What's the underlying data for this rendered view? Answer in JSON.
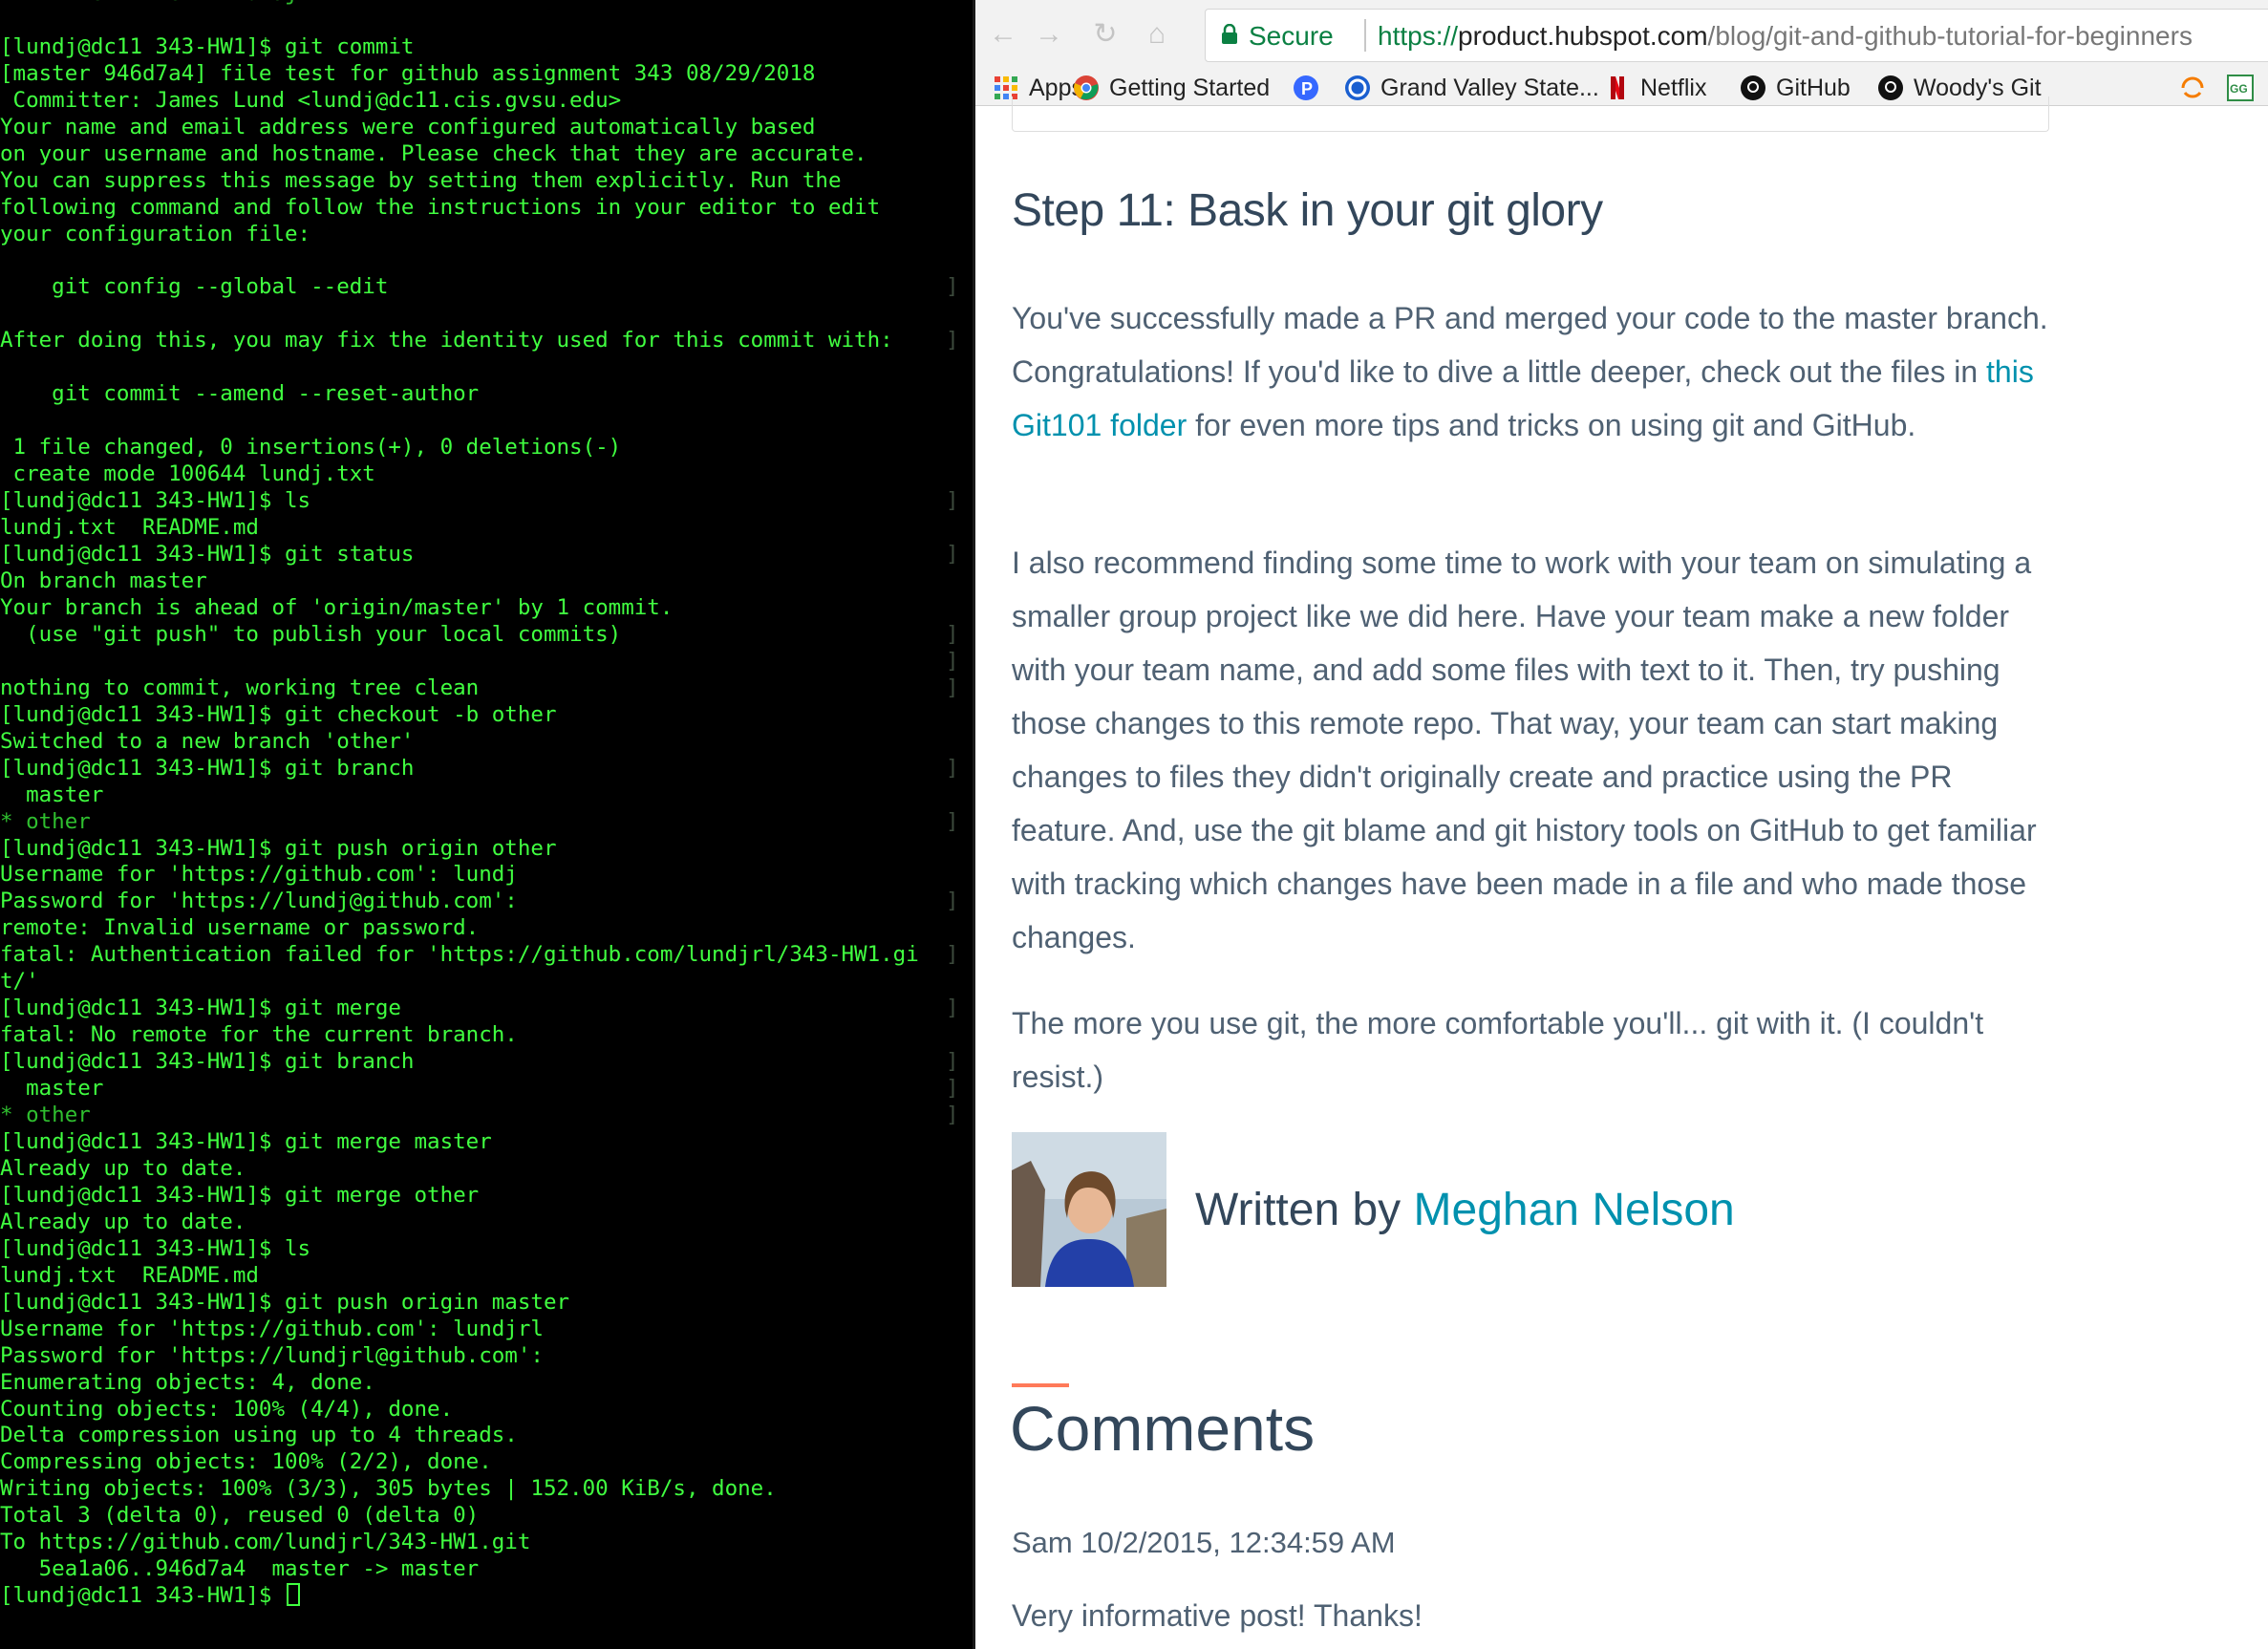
{
  "terminal": {
    "lines": [
      {
        "text": "      new file:   lundj.txt",
        "bracket": false,
        "dim": true
      },
      {
        "text": "",
        "bracket": false
      },
      {
        "text": "[lundj@dc11 343-HW1]$ git commit",
        "bracket": false
      },
      {
        "text": "[master 946d7a4] file test for github assignment 343 08/29/2018",
        "bracket": false
      },
      {
        "text": " Committer: James Lund <lundj@dc11.cis.gvsu.edu>",
        "bracket": false
      },
      {
        "text": "Your name and email address were configured automatically based",
        "bracket": false
      },
      {
        "text": "on your username and hostname. Please check that they are accurate.",
        "bracket": false
      },
      {
        "text": "You can suppress this message by setting them explicitly. Run the",
        "bracket": false
      },
      {
        "text": "following command and follow the instructions in your editor to edit",
        "bracket": false
      },
      {
        "text": "your configuration file:",
        "bracket": false
      },
      {
        "text": "",
        "bracket": false
      },
      {
        "text": "    git config --global --edit",
        "bracket": true
      },
      {
        "text": "",
        "bracket": false
      },
      {
        "text": "After doing this, you may fix the identity used for this commit with:",
        "bracket": true
      },
      {
        "text": "",
        "bracket": false
      },
      {
        "text": "    git commit --amend --reset-author",
        "bracket": false
      },
      {
        "text": "",
        "bracket": false
      },
      {
        "text": " 1 file changed, 0 insertions(+), 0 deletions(-)",
        "bracket": false
      },
      {
        "text": " create mode 100644 lundj.txt",
        "bracket": false
      },
      {
        "text": "[lundj@dc11 343-HW1]$ ls",
        "bracket": true
      },
      {
        "text": "lundj.txt  README.md",
        "bracket": false
      },
      {
        "text": "[lundj@dc11 343-HW1]$ git status",
        "bracket": true
      },
      {
        "text": "On branch master",
        "bracket": false
      },
      {
        "text": "Your branch is ahead of 'origin/master' by 1 commit.",
        "bracket": false
      },
      {
        "text": "  (use \"git push\" to publish your local commits)",
        "bracket": true
      },
      {
        "text": "",
        "bracket": true
      },
      {
        "text": "nothing to commit, working tree clean",
        "bracket": true
      },
      {
        "text": "[lundj@dc11 343-HW1]$ git checkout -b other",
        "bracket": false
      },
      {
        "text": "Switched to a new branch 'other'",
        "bracket": false
      },
      {
        "text": "[lundj@dc11 343-HW1]$ git branch",
        "bracket": true
      },
      {
        "text": "  master",
        "bracket": false
      },
      {
        "text": "* other",
        "bracket": true,
        "dim": true
      },
      {
        "text": "[lundj@dc11 343-HW1]$ git push origin other",
        "bracket": false
      },
      {
        "text": "Username for 'https://github.com': lundj",
        "bracket": false
      },
      {
        "text": "Password for 'https://lundj@github.com':",
        "bracket": true
      },
      {
        "text": "remote: Invalid username or password.",
        "bracket": false
      },
      {
        "text": "fatal: Authentication failed for 'https://github.com/lundjrl/343-HW1.gi",
        "bracket": true
      },
      {
        "text": "t/'",
        "bracket": false
      },
      {
        "text": "[lundj@dc11 343-HW1]$ git merge",
        "bracket": true
      },
      {
        "text": "fatal: No remote for the current branch.",
        "bracket": false
      },
      {
        "text": "[lundj@dc11 343-HW1]$ git branch",
        "bracket": true
      },
      {
        "text": "  master",
        "bracket": true
      },
      {
        "text": "* other",
        "bracket": true,
        "dim": true
      },
      {
        "text": "[lundj@dc11 343-HW1]$ git merge master",
        "bracket": false
      },
      {
        "text": "Already up to date.",
        "bracket": false
      },
      {
        "text": "[lundj@dc11 343-HW1]$ git merge other",
        "bracket": false
      },
      {
        "text": "Already up to date.",
        "bracket": false
      },
      {
        "text": "[lundj@dc11 343-HW1]$ ls",
        "bracket": false
      },
      {
        "text": "lundj.txt  README.md",
        "bracket": false
      },
      {
        "text": "[lundj@dc11 343-HW1]$ git push origin master",
        "bracket": false
      },
      {
        "text": "Username for 'https://github.com': lundjrl",
        "bracket": false
      },
      {
        "text": "Password for 'https://lundjrl@github.com':",
        "bracket": false
      },
      {
        "text": "Enumerating objects: 4, done.",
        "bracket": false
      },
      {
        "text": "Counting objects: 100% (4/4), done.",
        "bracket": false
      },
      {
        "text": "Delta compression using up to 4 threads.",
        "bracket": false
      },
      {
        "text": "Compressing objects: 100% (2/2), done.",
        "bracket": false
      },
      {
        "text": "Writing objects: 100% (3/3), 305 bytes | 152.00 KiB/s, done.",
        "bracket": false
      },
      {
        "text": "Total 3 (delta 0), reused 0 (delta 0)",
        "bracket": false
      },
      {
        "text": "To https://github.com/lundjrl/343-HW1.git",
        "bracket": false
      },
      {
        "text": "   5ea1a06..946d7a4  master -> master",
        "bracket": false
      },
      {
        "text": "[lundj@dc11 343-HW1]$ ",
        "bracket": false,
        "cursor": true
      }
    ],
    "bracket_char": "]"
  },
  "browser": {
    "nav": {
      "back_icon": "back-arrow-icon",
      "forward_icon": "forward-arrow-icon",
      "reload_icon": "reload-icon",
      "home_icon": "home-icon"
    },
    "omnibox": {
      "secure_label": "Secure",
      "url_scheme": "https://",
      "url_host": "product.hubspot.com",
      "url_path": "/blog/git-and-github-tutorial-for-beginners"
    },
    "bookmarks": [
      {
        "label": "Apps",
        "icon": "apps-grid-icon"
      },
      {
        "label": "Getting Started",
        "icon": "chrome-icon"
      },
      {
        "label": "",
        "icon": "pandora-icon"
      },
      {
        "label": "Grand Valley State...",
        "icon": "gvsu-icon"
      },
      {
        "label": "Netflix",
        "icon": "netflix-icon"
      },
      {
        "label": "GitHub",
        "icon": "github-icon"
      },
      {
        "label": "Woody's Git",
        "icon": "github-icon"
      },
      {
        "label": "",
        "icon": "loading-icon"
      },
      {
        "label": "",
        "icon": "gfg-icon"
      }
    ],
    "article": {
      "heading": "Step 11: Bask in your git glory",
      "p1_before": "You've successfully made a PR and merged your code to the master branch. Congratulations! If you'd like to dive a little deeper, check out the files in ",
      "p1_link": "this Git101 folder",
      "p1_after": " for even more tips and tricks on using git and GitHub.",
      "p2": "I also recommend finding some time to work with your team on simulating a smaller group project like we did here. Have your team make a new folder with your team name, and add some files with text to it. Then, try pushing those changes to this remote repo. That way, your team can start making changes to files they didn't originally create and practice using the PR feature. And, use the git blame and git history tools on GitHub to get familiar with tracking which changes have been made in a file and who made those changes.",
      "p3": "The more you use git, the more comfortable you'll... git with it. (I couldn't resist.)",
      "author_prefix": "Written by ",
      "author_name": "Meghan Nelson"
    },
    "comments": {
      "title": "Comments",
      "items": [
        {
          "meta": "Sam 10/2/2015, 12:34:59 AM",
          "body": "Very informative post! Thanks!"
        }
      ]
    },
    "colors": {
      "link": "#0091ae",
      "accent": "#ff7a59",
      "secure": "#0b8043"
    }
  }
}
